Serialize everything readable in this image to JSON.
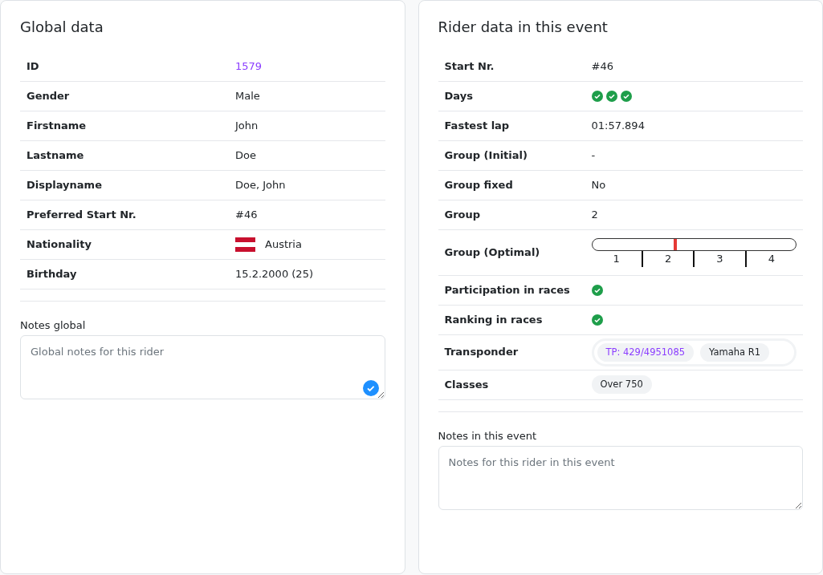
{
  "global": {
    "title": "Global data",
    "rows": [
      {
        "kind": "link",
        "label": "ID",
        "value": "1579"
      },
      {
        "kind": "text",
        "label": "Gender",
        "value": "Male"
      },
      {
        "kind": "text",
        "label": "Firstname",
        "value": "John"
      },
      {
        "kind": "text",
        "label": "Lastname",
        "value": "Doe"
      },
      {
        "kind": "text",
        "label": "Displayname",
        "value": "Doe, John"
      },
      {
        "kind": "text",
        "label": "Preferred Start Nr.",
        "value": "#46"
      },
      {
        "kind": "flag",
        "label": "Nationality",
        "value": "Austria"
      },
      {
        "kind": "text",
        "label": "Birthday",
        "value": "15.2.2000 (25)"
      }
    ],
    "notes": {
      "label": "Notes global",
      "placeholder": "Global notes for this rider"
    }
  },
  "event": {
    "title": "Rider data in this event",
    "rows": [
      {
        "kind": "text",
        "label": "Start Nr.",
        "value": "#46"
      },
      {
        "kind": "checks",
        "label": "Days",
        "checks": [
          {
            "checked": true
          },
          {
            "checked": true
          },
          {
            "checked": true
          }
        ]
      },
      {
        "kind": "text",
        "label": "Fastest lap",
        "value": "01:57.894"
      },
      {
        "kind": "text",
        "label": "Group (Initial)",
        "value": "-"
      },
      {
        "kind": "text",
        "label": "Group fixed",
        "value": "No"
      },
      {
        "kind": "text",
        "label": "Group",
        "value": "2"
      },
      {
        "kind": "scale",
        "label": "Group (Optimal)",
        "level": 0.41,
        "ticks": [
          "1",
          "2",
          "3",
          "4"
        ]
      },
      {
        "kind": "checks",
        "label": "Participation in races",
        "checks": [
          {
            "checked": true
          }
        ]
      },
      {
        "kind": "checks",
        "label": "Ranking in races",
        "checks": [
          {
            "checked": true
          }
        ]
      },
      {
        "kind": "chips",
        "label": "Transponder",
        "framed": true,
        "chips": [
          {
            "kind": "transponder",
            "text": "TP: 429/4951085"
          },
          {
            "kind": "vehicle",
            "text": "Yamaha R1"
          }
        ]
      },
      {
        "kind": "chips",
        "label": "Classes",
        "framed": false,
        "chips": [
          {
            "kind": "class",
            "text": "Over 750"
          }
        ]
      }
    ],
    "notes": {
      "label": "Notes in this event",
      "placeholder": "Notes for this rider in this event"
    }
  }
}
